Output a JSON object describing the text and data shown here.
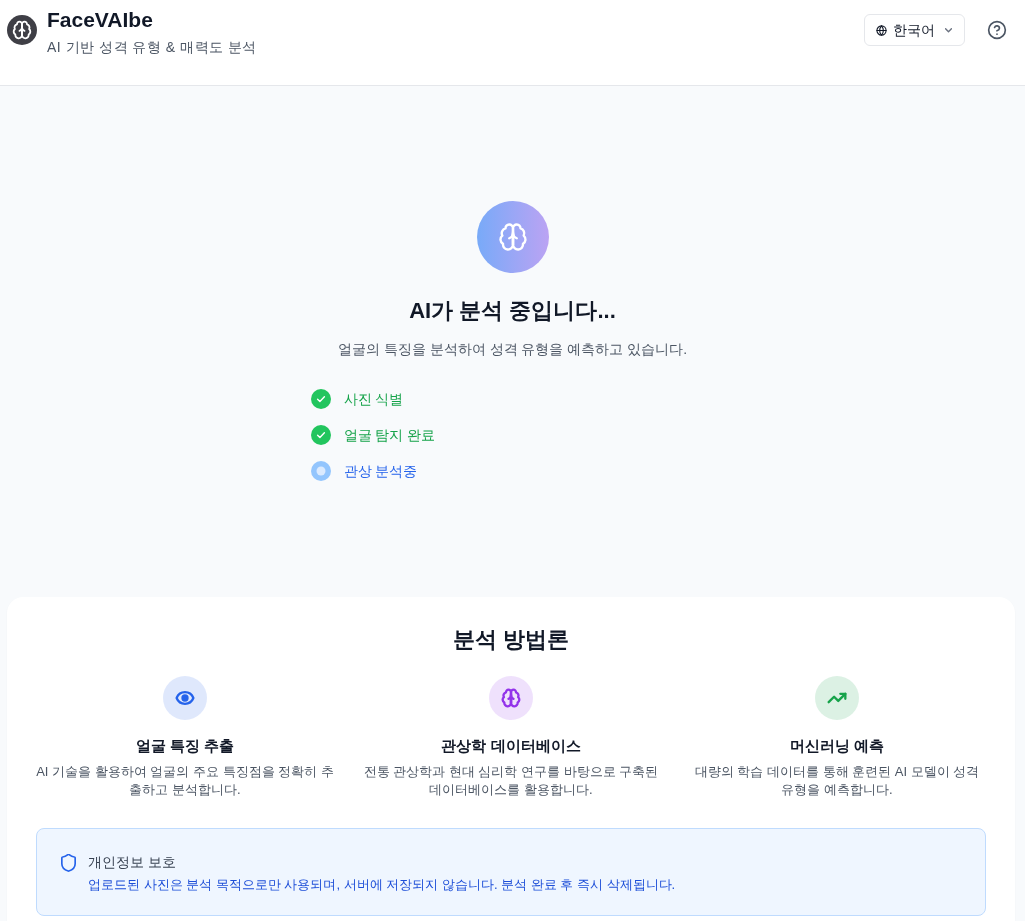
{
  "header": {
    "title": "FaceVAIbe",
    "subtitle": "AI 기반 성격 유형 & 매력도 분석",
    "language_button": {
      "label": "한국어"
    }
  },
  "analysis": {
    "title": "AI가 분석 중입니다...",
    "description": "얼굴의 특징을 분석하여 성격 유형을 예측하고 있습니다.",
    "steps": [
      {
        "label": "사진 식별",
        "completed": true
      },
      {
        "label": "얼굴 탐지 완료",
        "completed": true
      },
      {
        "label": "관상 분석중",
        "completed": false
      }
    ]
  },
  "methodology": {
    "title": "분석 방법론",
    "items": [
      {
        "color": "#2563eb",
        "title": "얼굴 특징 추출",
        "description": "AI 기술을 활용하여 얼굴의 주요 특징점을 정확히 추출하고 분석합니다."
      },
      {
        "color": "#9333ea",
        "title": "관상학 데이터베이스",
        "description": "전통 관상학과 현대 심리학 연구를 바탕으로 구축된 데이터베이스를 활용합니다."
      },
      {
        "color": "#16a34a",
        "title": "머신러닝 예측",
        "description": "대량의 학습 데이터를 통해 훈련된 AI 모델이 성격 유형을 예측합니다."
      }
    ]
  },
  "privacy_notice": {
    "title": "개인정보 보호",
    "text": "업로드된 사진은 분석 목적으로만 사용되며, 서버에 저장되지 않습니다. 분석 완료 후 즉시 삭제됩니다."
  }
}
